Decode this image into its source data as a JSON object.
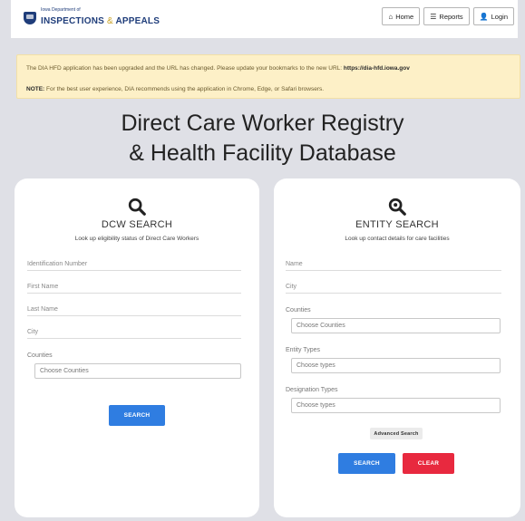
{
  "header": {
    "logo_small": "Iowa Department of",
    "logo_main": "INSPECTIONS",
    "logo_amp": "&",
    "logo_end": "APPEALS",
    "nav": {
      "home": "Home",
      "reports": "Reports",
      "login": "Login"
    }
  },
  "alert": {
    "line1_text": "The DIA HFD application has been upgraded and the URL has changed. Please update your bookmarks to the new URL: ",
    "line1_url": "https://dia-hfd.iowa.gov",
    "line2_label": "NOTE:",
    "line2_text": " For the best user experience, DIA recommends using the application in Chrome, Edge, or Safari browsers."
  },
  "page_title": {
    "line1": "Direct Care Worker Registry",
    "line2": "& Health Facility Database"
  },
  "dcw": {
    "title": "DCW SEARCH",
    "subtitle": "Look up eligibility status of Direct Care Workers",
    "fields": {
      "id": "Identification Number",
      "first": "First Name",
      "last": "Last Name",
      "city": "City"
    },
    "counties_label": "Counties",
    "counties_placeholder": "Choose Counties",
    "search_label": "SEARCH"
  },
  "entity": {
    "title": "ENTITY SEARCH",
    "subtitle": "Look up contact details for care facilities",
    "fields": {
      "name": "Name",
      "city": "City"
    },
    "counties_label": "Counties",
    "counties_placeholder": "Choose Counties",
    "types_label": "Entity Types",
    "types_placeholder": "Choose types",
    "designation_label": "Designation Types",
    "designation_placeholder": "Choose types",
    "advanced_label": "Advanced Search",
    "search_label": "SEARCH",
    "clear_label": "CLEAR"
  },
  "colors": {
    "brand": "#1f3d7a",
    "accent_blue": "#2f7de1",
    "accent_red": "#e8293f",
    "alert_bg": "#fdf0c7"
  }
}
